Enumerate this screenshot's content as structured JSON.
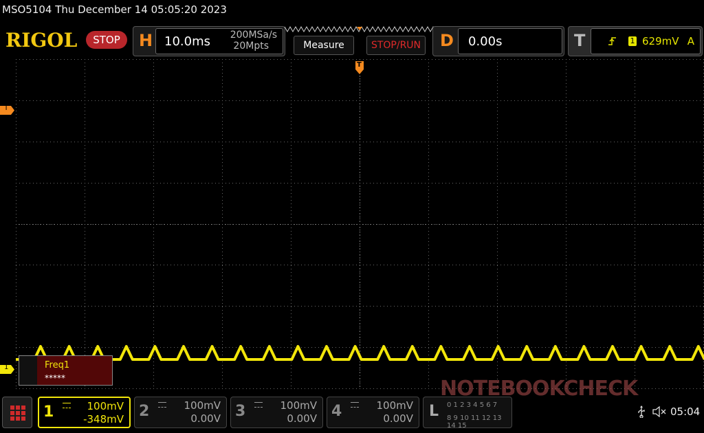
{
  "header": {
    "model_datetime": "MSO5104  Thu December 14 05:05:20 2023",
    "brand": "RIGOL",
    "run_state": "STOP"
  },
  "horizontal": {
    "label": "H",
    "timebase": "10.0ms",
    "sample_rate": "200MSa/s",
    "memory_depth": "20Mpts"
  },
  "buttons": {
    "measure": "Measure",
    "stop_run": "STOP/RUN"
  },
  "delay": {
    "label": "D",
    "value": "0.00s"
  },
  "trigger": {
    "label": "T",
    "source": "1",
    "level": "629mV",
    "mode": "A"
  },
  "markers": {
    "trigger_top": "T",
    "trigger_left": "T",
    "channel1": "1"
  },
  "measurement": {
    "name": "Freq1",
    "value": "*****"
  },
  "channels": [
    {
      "num": "1",
      "scale": "100mV",
      "offset": "-348mV",
      "color": "#f2e60a"
    },
    {
      "num": "2",
      "scale": "100mV",
      "offset": "0.00V",
      "color": "#aaaaaa"
    },
    {
      "num": "3",
      "scale": "100mV",
      "offset": "0.00V",
      "color": "#aaaaaa"
    },
    {
      "num": "4",
      "scale": "100mV",
      "offset": "0.00V",
      "color": "#aaaaaa"
    }
  ],
  "logic": {
    "label": "L",
    "row1": "0 1 2 3 4 5 6 7",
    "row2": "8 9 10 11 12 13 14 15"
  },
  "status": {
    "clock": "05:04"
  },
  "watermark": "NOTEBOOKCHECK",
  "colors": {
    "accent": "#f58a1f",
    "trace": "#f2e60a",
    "stop": "#b8262b",
    "trigger_level": "#e6e600"
  }
}
